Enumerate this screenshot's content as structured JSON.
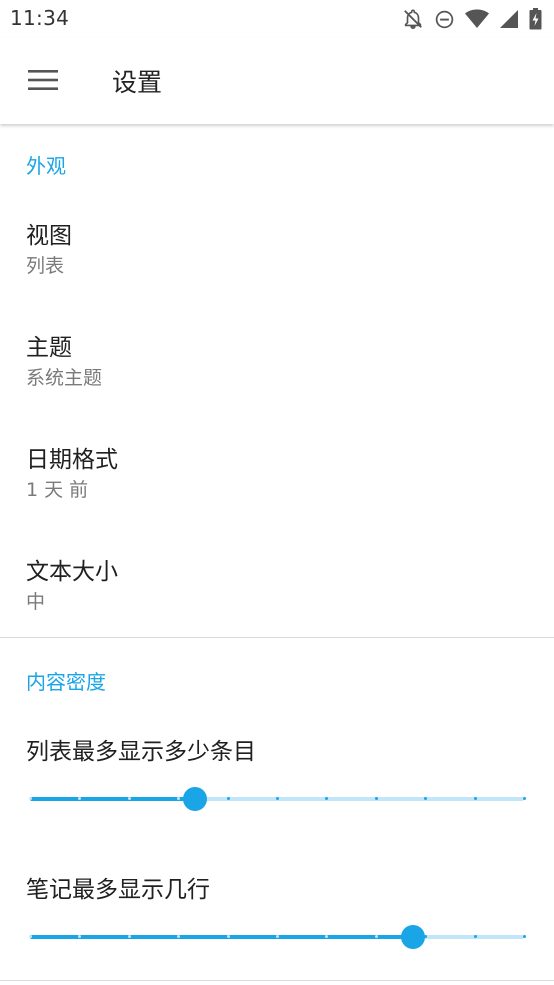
{
  "status_bar": {
    "time": "11:34",
    "icons": [
      "notifications-off-icon",
      "do-not-disturb-icon",
      "wifi-icon",
      "cellular-signal-icon",
      "battery-charging-icon"
    ]
  },
  "app_bar": {
    "menu_icon": "hamburger-menu-icon",
    "title": "设置"
  },
  "appearance": {
    "header": "外观",
    "items": [
      {
        "title": "视图",
        "summary": "列表"
      },
      {
        "title": "主题",
        "summary": "系统主题"
      },
      {
        "title": "日期格式",
        "summary": "1 天 前"
      },
      {
        "title": "文本大小",
        "summary": "中"
      }
    ]
  },
  "density": {
    "header": "内容密度",
    "sliders": [
      {
        "title": "列表最多显示多少条目",
        "steps": 10,
        "value_fraction": 0.333
      },
      {
        "title": "笔记最多显示几行",
        "steps": 10,
        "value_fraction": 0.775
      }
    ]
  },
  "colors": {
    "accent": "#1aa5e6",
    "accent_light": "#c2e6f9"
  }
}
